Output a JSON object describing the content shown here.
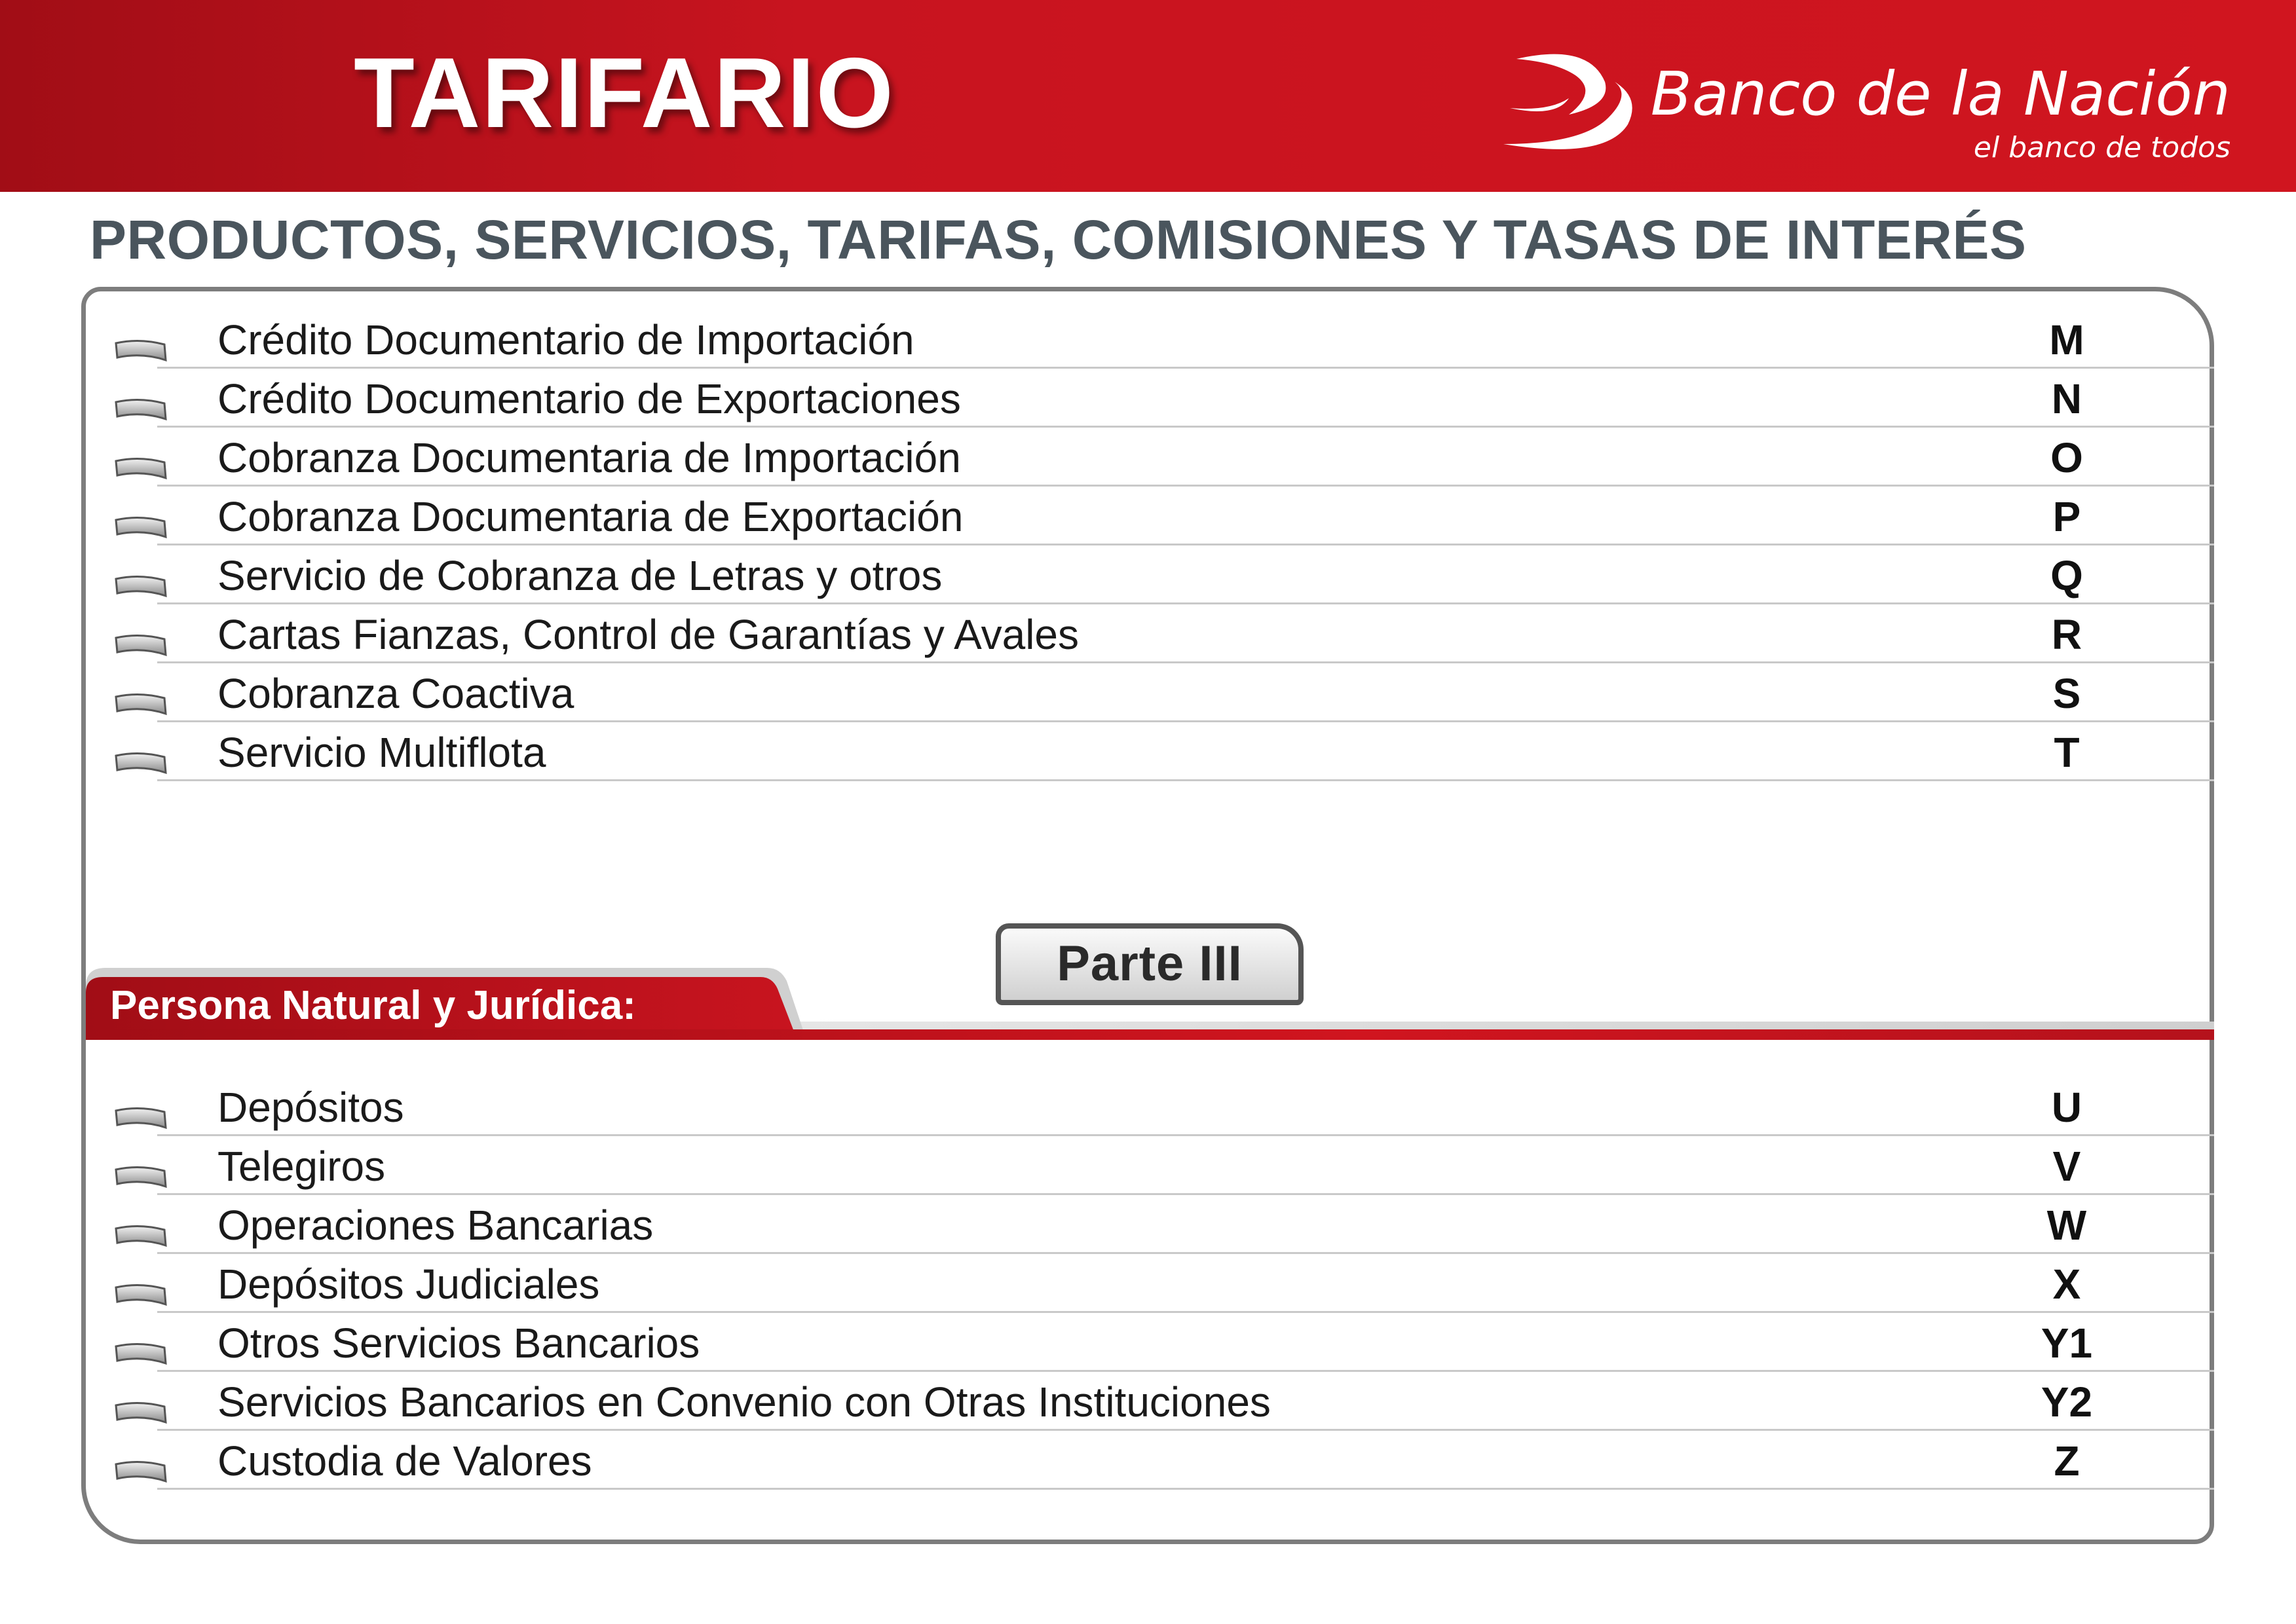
{
  "header": {
    "title": "TARIFARIO",
    "brand_name": "Banco de la Nación",
    "brand_tagline": "el banco de todos"
  },
  "subtitle": "PRODUCTOS, SERVICIOS, TARIFAS, COMISIONES Y TASAS DE INTERÉS",
  "list_top": [
    {
      "label": "Crédito Documentario de Importación",
      "code": "M"
    },
    {
      "label": "Crédito Documentario de Exportaciones",
      "code": "N"
    },
    {
      "label": "Cobranza Documentaria de Importación",
      "code": "O"
    },
    {
      "label": "Cobranza Documentaria de Exportación",
      "code": "P"
    },
    {
      "label": "Servicio de Cobranza de Letras y otros",
      "code": "Q"
    },
    {
      "label": "Cartas Fianzas, Control de Garantías y Avales",
      "code": "R"
    },
    {
      "label": "Cobranza Coactiva",
      "code": "S"
    },
    {
      "label": "Servicio Multiflota",
      "code": "T"
    }
  ],
  "section": {
    "label": "Persona Natural y Jurídica:",
    "part": "Parte III"
  },
  "list_bottom": [
    {
      "label": "Depósitos",
      "code": "U"
    },
    {
      "label": "Telegiros",
      "code": "V"
    },
    {
      "label": "Operaciones Bancarias",
      "code": "W"
    },
    {
      "label": "Depósitos Judiciales",
      "code": "X"
    },
    {
      "label": "Otros Servicios Bancarios",
      "code": "Y1"
    },
    {
      "label": "Servicios Bancarios en Convenio con Otras Instituciones",
      "code": "Y2"
    },
    {
      "label": "Custodia de Valores",
      "code": "Z"
    }
  ],
  "colors": {
    "brand_red": "#c8141f",
    "heading_grey": "#4a555d",
    "frame_grey": "#7d7d7d"
  }
}
